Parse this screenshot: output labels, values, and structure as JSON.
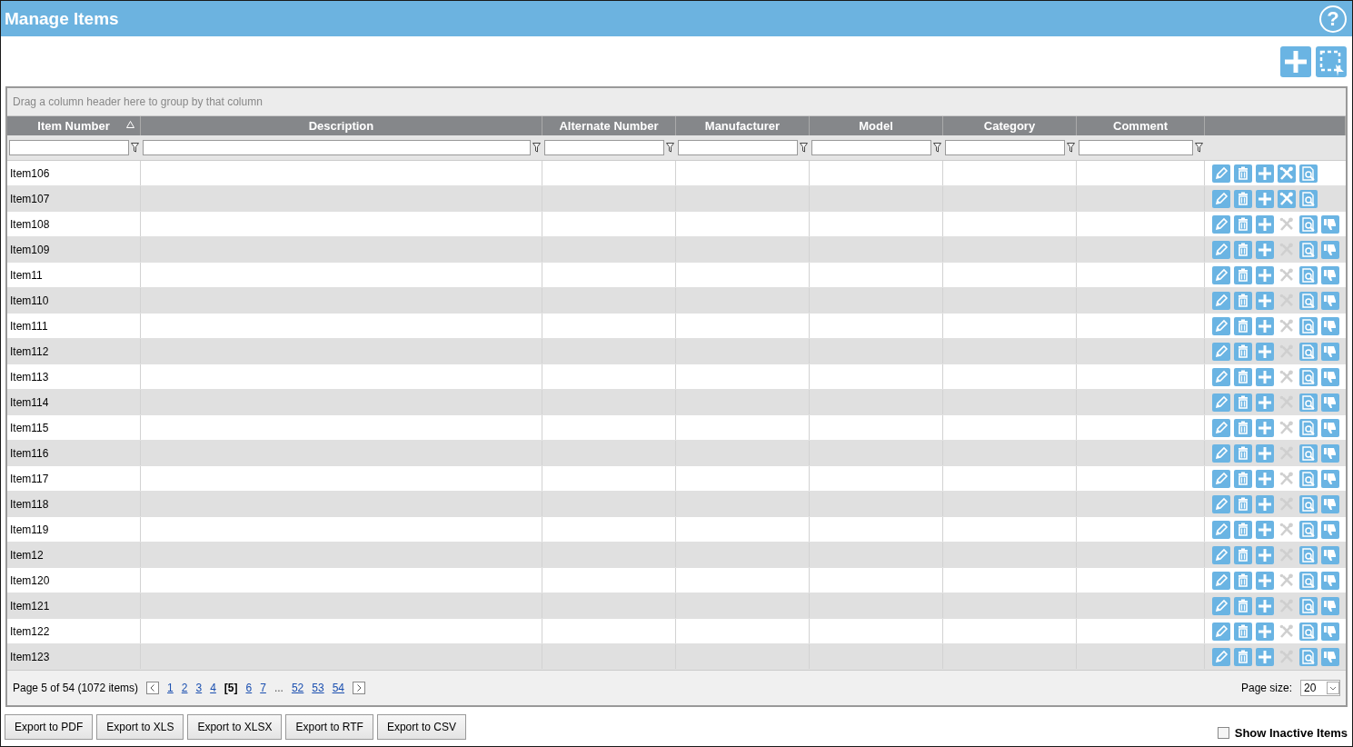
{
  "window": {
    "title": "Manage Items",
    "help": "?"
  },
  "grid": {
    "group_hint": "Drag a column header here to group by that column",
    "columns": [
      {
        "label": "Item Number",
        "sorted": true
      },
      {
        "label": "Description",
        "sorted": false
      },
      {
        "label": "Alternate Number",
        "sorted": false
      },
      {
        "label": "Manufacturer",
        "sorted": false
      },
      {
        "label": "Model",
        "sorted": false
      },
      {
        "label": "Category",
        "sorted": false
      },
      {
        "label": "Comment",
        "sorted": false
      }
    ],
    "rows": [
      {
        "item": "Item106",
        "tools_disabled": false,
        "thumbs_down": false
      },
      {
        "item": "Item107",
        "tools_disabled": false,
        "thumbs_down": false
      },
      {
        "item": "Item108",
        "tools_disabled": true,
        "thumbs_down": true
      },
      {
        "item": "Item109",
        "tools_disabled": true,
        "thumbs_down": true
      },
      {
        "item": "Item11",
        "tools_disabled": true,
        "thumbs_down": true
      },
      {
        "item": "Item110",
        "tools_disabled": true,
        "thumbs_down": true
      },
      {
        "item": "Item111",
        "tools_disabled": true,
        "thumbs_down": true
      },
      {
        "item": "Item112",
        "tools_disabled": true,
        "thumbs_down": true
      },
      {
        "item": "Item113",
        "tools_disabled": true,
        "thumbs_down": true
      },
      {
        "item": "Item114",
        "tools_disabled": true,
        "thumbs_down": true
      },
      {
        "item": "Item115",
        "tools_disabled": true,
        "thumbs_down": true
      },
      {
        "item": "Item116",
        "tools_disabled": true,
        "thumbs_down": true
      },
      {
        "item": "Item117",
        "tools_disabled": true,
        "thumbs_down": true
      },
      {
        "item": "Item118",
        "tools_disabled": true,
        "thumbs_down": true
      },
      {
        "item": "Item119",
        "tools_disabled": true,
        "thumbs_down": true
      },
      {
        "item": "Item12",
        "tools_disabled": true,
        "thumbs_down": true
      },
      {
        "item": "Item120",
        "tools_disabled": true,
        "thumbs_down": true
      },
      {
        "item": "Item121",
        "tools_disabled": true,
        "thumbs_down": true
      },
      {
        "item": "Item122",
        "tools_disabled": true,
        "thumbs_down": true
      },
      {
        "item": "Item123",
        "tools_disabled": true,
        "thumbs_down": true
      }
    ],
    "pager": {
      "summary": "Page 5 of 54 (1072 items)",
      "pages": [
        {
          "kind": "page",
          "label": "1",
          "selected": false
        },
        {
          "kind": "page",
          "label": "2",
          "selected": false
        },
        {
          "kind": "page",
          "label": "3",
          "selected": false
        },
        {
          "kind": "page",
          "label": "4",
          "selected": false
        },
        {
          "kind": "page",
          "label": "[5]",
          "selected": true
        },
        {
          "kind": "page",
          "label": "6",
          "selected": false
        },
        {
          "kind": "page",
          "label": "7",
          "selected": false
        },
        {
          "kind": "ellipsis",
          "label": "..."
        },
        {
          "kind": "page",
          "label": "52",
          "selected": false
        },
        {
          "kind": "page",
          "label": "53",
          "selected": false
        },
        {
          "kind": "page",
          "label": "54",
          "selected": false
        }
      ],
      "page_size_label": "Page size:",
      "page_size": "20"
    }
  },
  "export_buttons": [
    "Export to PDF",
    "Export to XLS",
    "Export to XLSX",
    "Export to RTF",
    "Export to CSV"
  ],
  "show_inactive": {
    "label": "Show Inactive Items",
    "checked": false
  }
}
